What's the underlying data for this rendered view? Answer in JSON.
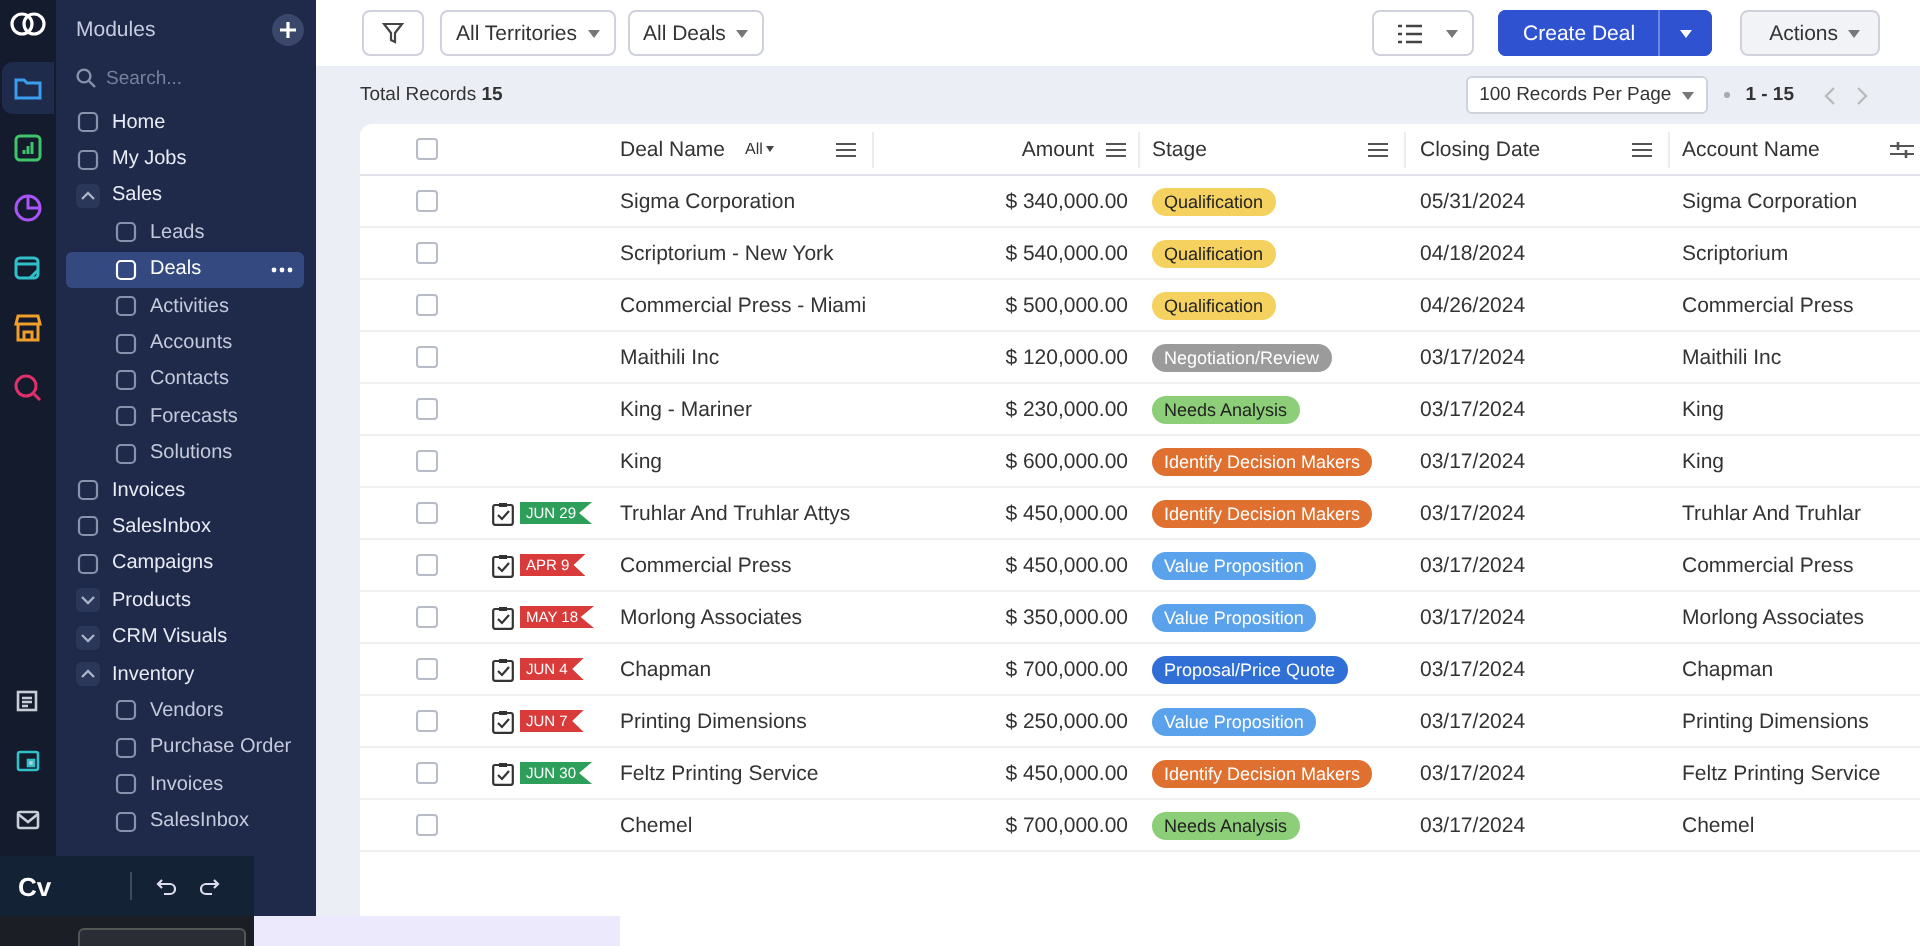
{
  "rail": {
    "top": [
      {
        "kind": "folder",
        "selected": true
      },
      {
        "kind": "chart",
        "selected": false
      },
      {
        "kind": "pie",
        "selected": false
      },
      {
        "kind": "calendar",
        "selected": false
      },
      {
        "kind": "store",
        "selected": false
      },
      {
        "kind": "search",
        "selected": false
      }
    ],
    "bottom": [
      {
        "kind": "note"
      },
      {
        "kind": "calendar"
      },
      {
        "kind": "mail"
      }
    ]
  },
  "sidebar": {
    "title": "Modules",
    "search": {
      "placeholder": "Search..."
    },
    "items": [
      {
        "label": "Home",
        "selected": false
      },
      {
        "label": "My Jobs",
        "selected": false
      },
      {
        "label": "Sales",
        "expanded": true,
        "selected": false,
        "children": [
          {
            "label": "Leads",
            "selected": false
          },
          {
            "label": "Deals",
            "selected": true
          },
          {
            "label": "Activities",
            "selected": false
          },
          {
            "label": "Accounts",
            "selected": false
          },
          {
            "label": "Contacts",
            "selected": false
          },
          {
            "label": "Forecasts",
            "selected": false
          },
          {
            "label": "Solutions",
            "selected": false
          }
        ]
      },
      {
        "label": "Invoices",
        "selected": false
      },
      {
        "label": "SalesInbox",
        "selected": false
      },
      {
        "label": "Campaigns",
        "selected": false
      },
      {
        "label": "Products",
        "kind": "group",
        "expanded": false,
        "selected": false
      },
      {
        "label": "CRM Visuals",
        "kind": "group",
        "expanded": false,
        "selected": false
      },
      {
        "label": "Inventory",
        "expanded": true,
        "selected": false,
        "children": [
          {
            "label": "Vendors",
            "selected": false
          },
          {
            "label": "Purchase Order",
            "selected": false
          },
          {
            "label": "Invoices",
            "selected": false
          },
          {
            "label": "SalesInbox",
            "selected": false
          }
        ]
      }
    ]
  },
  "toolbar": {
    "filters": [
      "All Territories",
      "All Deals"
    ],
    "create": "Create Deal",
    "actions": "Actions"
  },
  "records": {
    "label": "Total Records",
    "count": "15",
    "per_page": "100 Records Per Page",
    "range": "1 - 15"
  },
  "table": {
    "select_all": {
      "checked": false
    },
    "columns": [
      {
        "label": "Deal Name",
        "filter": "All"
      },
      {
        "label": "Amount"
      },
      {
        "label": "Stage"
      },
      {
        "label": "Closing Date"
      },
      {
        "label": "Account Name"
      }
    ],
    "rows": [
      {
        "checked": false,
        "deal": "Sigma Corporation",
        "amount": "$ 340,000.00",
        "stage": {
          "label": "Qualification",
          "color": "#f5d160"
        },
        "closing": "05/31/2024",
        "account": "Sigma Corporation"
      },
      {
        "checked": false,
        "deal": "Scriptorium - New York",
        "amount": "$ 540,000.00",
        "stage": {
          "label": "Qualification",
          "color": "#f5d160"
        },
        "closing": "04/18/2024",
        "account": "Scriptorium"
      },
      {
        "checked": false,
        "deal": "Commercial Press - Miami",
        "amount": "$ 500,000.00",
        "stage": {
          "label": "Qualification",
          "color": "#f5d160"
        },
        "closing": "04/26/2024",
        "account": "Commercial Press"
      },
      {
        "checked": false,
        "deal": "Maithili Inc",
        "amount": "$ 120,000.00",
        "stage": {
          "label": "Negotiation/Review",
          "color": "#9b9b9b"
        },
        "closing": "03/17/2024",
        "account": "Maithili Inc"
      },
      {
        "checked": false,
        "deal": "King - Mariner",
        "amount": "$ 230,000.00",
        "stage": {
          "label": "Needs Analysis",
          "color": "#8ccf78"
        },
        "closing": "03/17/2024",
        "account": "King"
      },
      {
        "checked": false,
        "deal": "King",
        "amount": "$ 600,000.00",
        "stage": {
          "label": "Identify Decision Makers",
          "color": "#e07030"
        },
        "closing": "03/17/2024",
        "account": "King"
      },
      {
        "checked": false,
        "task": {
          "label": "JUN 29",
          "color": "#2e9e5b"
        },
        "deal": "Truhlar And Truhlar Attys",
        "amount": "$ 450,000.00",
        "stage": {
          "label": "Identify Decision Makers",
          "color": "#e07030"
        },
        "closing": "03/17/2024",
        "account": "Truhlar And Truhlar"
      },
      {
        "checked": false,
        "task": {
          "label": "APR 9",
          "color": "#d93b3b"
        },
        "deal": "Commercial Press",
        "amount": "$ 450,000.00",
        "stage": {
          "label": "Value Proposition",
          "color": "#5aa3ec"
        },
        "closing": "03/17/2024",
        "account": "Commercial Press"
      },
      {
        "checked": false,
        "task": {
          "label": "MAY 18",
          "color": "#d93b3b"
        },
        "deal": "Morlong Associates",
        "amount": "$ 350,000.00",
        "stage": {
          "label": "Value Proposition",
          "color": "#5aa3ec"
        },
        "closing": "03/17/2024",
        "account": "Morlong Associates"
      },
      {
        "checked": false,
        "task": {
          "label": "JUN 4",
          "color": "#d93b3b"
        },
        "deal": "Chapman",
        "amount": "$ 700,000.00",
        "stage": {
          "label": "Proposal/Price Quote",
          "color": "#2f6fd6"
        },
        "closing": "03/17/2024",
        "account": "Chapman"
      },
      {
        "checked": false,
        "task": {
          "label": "JUN 7",
          "color": "#d93b3b"
        },
        "deal": "Printing Dimensions",
        "amount": "$ 250,000.00",
        "stage": {
          "label": "Value Proposition",
          "color": "#5aa3ec"
        },
        "closing": "03/17/2024",
        "account": "Printing Dimensions"
      },
      {
        "checked": false,
        "task": {
          "label": "JUN 30",
          "color": "#2e9e5b"
        },
        "deal": "Feltz Printing Service",
        "amount": "$ 450,000.00",
        "stage": {
          "label": "Identify Decision Makers",
          "color": "#e07030"
        },
        "closing": "03/17/2024",
        "account": "Feltz Printing Service"
      },
      {
        "checked": false,
        "deal": "Chemel",
        "amount": "$ 700,000.00",
        "stage": {
          "label": "Needs Analysis",
          "color": "#8ccf78"
        },
        "closing": "03/17/2024",
        "account": "Chemel"
      }
    ]
  },
  "overlay": {
    "logo": "Cv"
  }
}
